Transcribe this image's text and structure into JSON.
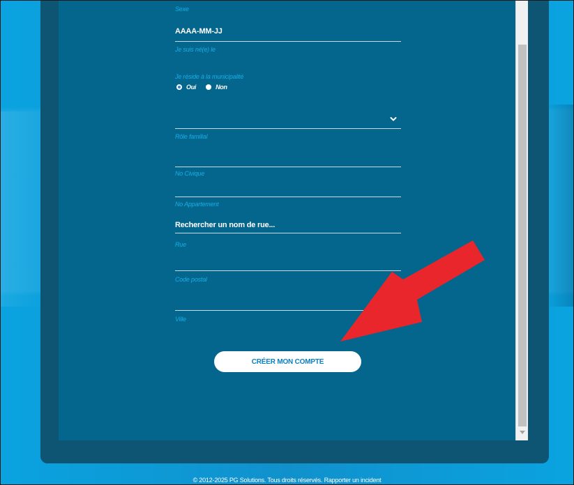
{
  "form": {
    "sex_label": "Sexe",
    "birth_value": "AAAA-MM-JJ",
    "birth_label": "Je suis né(e) le",
    "resident_label": "Je réside à la municipalité",
    "resident_options": [
      {
        "label": "Oui",
        "selected": true
      },
      {
        "label": "Non",
        "selected": false
      }
    ],
    "family_role_label": "Rôle familial",
    "civic_label": "No Civique",
    "apartment_label": "No Appartement",
    "street_search_value": "Rechercher un nom de rue...",
    "street_label": "Rue",
    "postal_label": "Code postal",
    "city_label": "Ville",
    "submit_label": "CRÉER MON COMPTE"
  },
  "footer": {
    "copyright": "© 2012-2025 PG Solutions. Tous droits réservés.",
    "report_link": "Rapporter un incident"
  },
  "colors": {
    "panel": "#04668d",
    "label": "#17aee6",
    "button_text": "#0b7ec2",
    "arrow": "#e8262b"
  }
}
